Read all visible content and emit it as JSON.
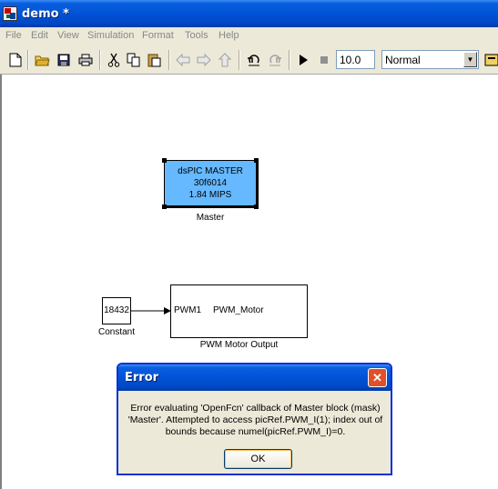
{
  "window": {
    "title": "demo *"
  },
  "menu": [
    "File",
    "Edit",
    "View",
    "Simulation",
    "Format",
    "Tools",
    "Help"
  ],
  "toolbar": {
    "stop_time": "10.0",
    "sim_mode": "Normal"
  },
  "blocks": {
    "master": {
      "lines": [
        "dsPIC MASTER",
        "30f6014",
        "1.84 MIPS"
      ],
      "label": "Master"
    },
    "constant": {
      "value": "18432",
      "label": "Constant"
    },
    "pwm": {
      "port": "PWM1",
      "name": "PWM_Motor",
      "label": "PWM Motor Output"
    }
  },
  "dialog": {
    "title": "Error",
    "message": "Error evaluating 'OpenFcn' callback of Master block (mask) 'Master'. Attempted to access picRef.PWM_I(1); index out of bounds because numel(picRef.PWM_I)=0.",
    "ok_label": "OK"
  }
}
